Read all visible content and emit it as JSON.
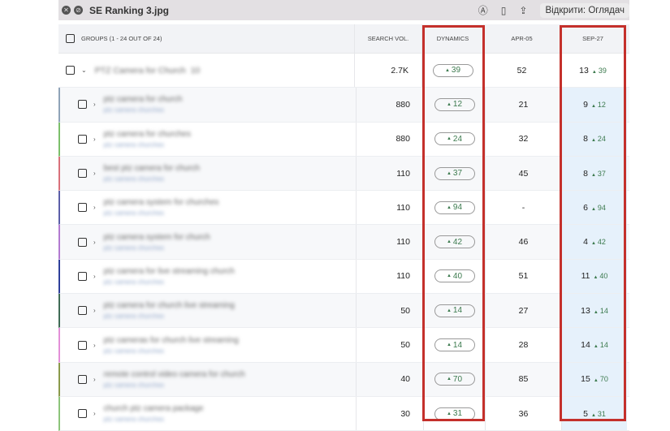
{
  "window": {
    "title": "SE Ranking 3.jpg",
    "open_label": "Відкрити: Оглядач"
  },
  "header": {
    "groups": "GROUPS (1 - 24 OUT OF 24)",
    "search_vol": "SEARCH VOL.",
    "dynamics": "DYNAMICS",
    "apr": "APR-05",
    "sep": "SEP-27"
  },
  "group": {
    "name": "PTZ Camera for Church",
    "count": "10",
    "search_vol": "2.7K",
    "dynamics": "39",
    "apr": "52",
    "sep_pos": "13",
    "sep_gain": "39"
  },
  "rows": [
    {
      "kw": "ptz camera for church",
      "sub": "ptz camera churches",
      "vol": "880",
      "dyn": "12",
      "apr": "21",
      "pos": "9",
      "gain": "12",
      "color": "#8fa3b8"
    },
    {
      "kw": "ptz camera for churches",
      "sub": "ptz camera churches",
      "vol": "880",
      "dyn": "24",
      "apr": "32",
      "pos": "8",
      "gain": "24",
      "color": "#7cbf6a"
    },
    {
      "kw": "best ptz camera for church",
      "sub": "ptz camera churches",
      "vol": "110",
      "dyn": "37",
      "apr": "45",
      "pos": "8",
      "gain": "37",
      "color": "#d9707a"
    },
    {
      "kw": "ptz camera system for churches",
      "sub": "ptz camera churches",
      "vol": "110",
      "dyn": "94",
      "apr": "-",
      "pos": "6",
      "gain": "94",
      "color": "#5b5ea8"
    },
    {
      "kw": "ptz camera system for church",
      "sub": "ptz camera churches",
      "vol": "110",
      "dyn": "42",
      "apr": "46",
      "pos": "4",
      "gain": "42",
      "color": "#b27ad0"
    },
    {
      "kw": "ptz camera for live streaming church",
      "sub": "ptz camera churches",
      "vol": "110",
      "dyn": "40",
      "apr": "51",
      "pos": "11",
      "gain": "40",
      "color": "#2e3f9a"
    },
    {
      "kw": "ptz camera for church live streaming",
      "sub": "ptz camera churches",
      "vol": "50",
      "dyn": "14",
      "apr": "27",
      "pos": "13",
      "gain": "14",
      "color": "#3f6b55"
    },
    {
      "kw": "ptz cameras for church live streaming",
      "sub": "ptz camera churches",
      "vol": "50",
      "dyn": "14",
      "apr": "28",
      "pos": "14",
      "gain": "14",
      "color": "#e38fd8"
    },
    {
      "kw": "remote control video camera for church",
      "sub": "ptz camera churches",
      "vol": "40",
      "dyn": "70",
      "apr": "85",
      "pos": "15",
      "gain": "70",
      "color": "#8a9a4a"
    },
    {
      "kw": "church ptz camera package",
      "sub": "ptz camera churches",
      "vol": "30",
      "dyn": "31",
      "apr": "36",
      "pos": "5",
      "gain": "31",
      "color": "#8cc47a"
    }
  ]
}
